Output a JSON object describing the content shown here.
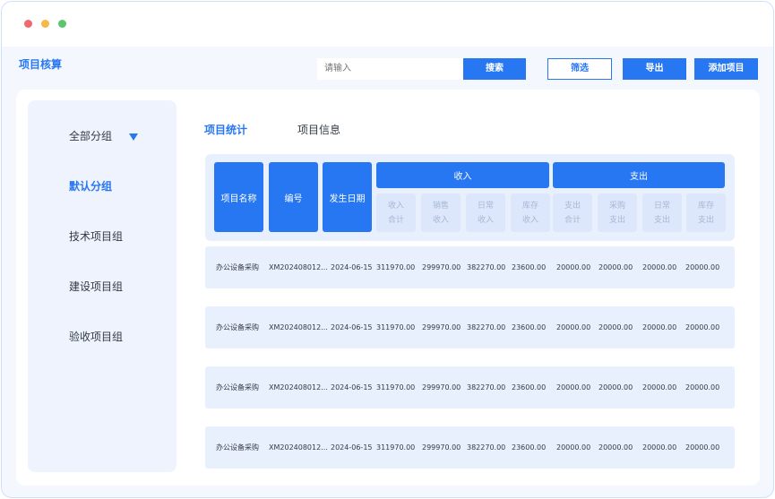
{
  "app": {
    "title": "项目核算"
  },
  "toolbar": {
    "search_placeholder": "请输入",
    "search_label": "搜索",
    "filter_label": "筛选",
    "export_label": "导出",
    "add_label": "添加项目"
  },
  "sidebar": {
    "items": [
      {
        "label": "全部分组"
      },
      {
        "label": "默认分组"
      },
      {
        "label": "技术项目组"
      },
      {
        "label": "建设项目组"
      },
      {
        "label": "验收项目组"
      }
    ]
  },
  "tabs": [
    {
      "label": "项目统计"
    },
    {
      "label": "项目信息"
    }
  ],
  "table": {
    "headers": {
      "name": "项目名称",
      "code": "编号",
      "date": "发生日期",
      "income": "收入",
      "expense": "支出",
      "income_sub": [
        {
          "l1": "收入",
          "l2": "合计"
        },
        {
          "l1": "销售",
          "l2": "收入"
        },
        {
          "l1": "日常",
          "l2": "收入"
        },
        {
          "l1": "库存",
          "l2": "收入"
        }
      ],
      "expense_sub": [
        {
          "l1": "支出",
          "l2": "合计"
        },
        {
          "l1": "采购",
          "l2": "支出"
        },
        {
          "l1": "日常",
          "l2": "支出"
        },
        {
          "l1": "库存",
          "l2": "支出"
        }
      ]
    },
    "rows": [
      {
        "name": "办公设备采购",
        "code": "XM202408012...",
        "date": "2024-06-15",
        "c0": "311970.00",
        "c1": "299970.00",
        "c2": "382270.00",
        "c3": "23600.00",
        "c4": "20000.00",
        "c5": "20000.00",
        "c6": "20000.00",
        "c7": "20000.00"
      },
      {
        "name": "办公设备采购",
        "code": "XM202408012...",
        "date": "2024-06-15",
        "c0": "311970.00",
        "c1": "299970.00",
        "c2": "382270.00",
        "c3": "23600.00",
        "c4": "20000.00",
        "c5": "20000.00",
        "c6": "20000.00",
        "c7": "20000.00"
      },
      {
        "name": "办公设备采购",
        "code": "XM202408012...",
        "date": "2024-06-15",
        "c0": "311970.00",
        "c1": "299970.00",
        "c2": "382270.00",
        "c3": "23600.00",
        "c4": "20000.00",
        "c5": "20000.00",
        "c6": "20000.00",
        "c7": "20000.00"
      },
      {
        "name": "办公设备采购",
        "code": "XM202408012...",
        "date": "2024-06-15",
        "c0": "311970.00",
        "c1": "299970.00",
        "c2": "382270.00",
        "c3": "23600.00",
        "c4": "20000.00",
        "c5": "20000.00",
        "c6": "20000.00",
        "c7": "20000.00"
      }
    ]
  },
  "colors": {
    "accent": "#2877f2",
    "row_bg": "#e9f0fd",
    "sidebar_bg": "#eef3fd"
  }
}
